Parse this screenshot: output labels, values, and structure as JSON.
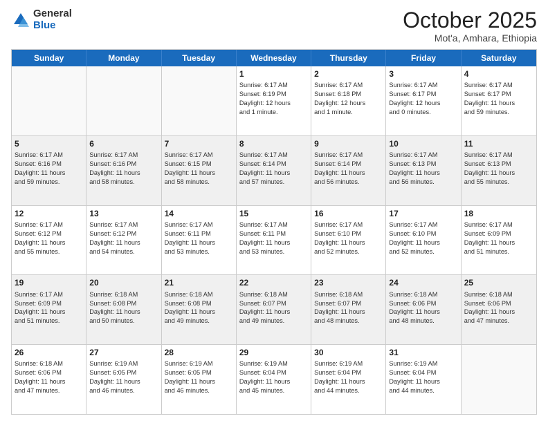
{
  "logo": {
    "general": "General",
    "blue": "Blue"
  },
  "title": "October 2025",
  "subtitle": "Mot'a, Amhara, Ethiopia",
  "days": [
    "Sunday",
    "Monday",
    "Tuesday",
    "Wednesday",
    "Thursday",
    "Friday",
    "Saturday"
  ],
  "weeks": [
    [
      {
        "day": "",
        "info": ""
      },
      {
        "day": "",
        "info": ""
      },
      {
        "day": "",
        "info": ""
      },
      {
        "day": "1",
        "info": "Sunrise: 6:17 AM\nSunset: 6:19 PM\nDaylight: 12 hours\nand 1 minute."
      },
      {
        "day": "2",
        "info": "Sunrise: 6:17 AM\nSunset: 6:18 PM\nDaylight: 12 hours\nand 1 minute."
      },
      {
        "day": "3",
        "info": "Sunrise: 6:17 AM\nSunset: 6:17 PM\nDaylight: 12 hours\nand 0 minutes."
      },
      {
        "day": "4",
        "info": "Sunrise: 6:17 AM\nSunset: 6:17 PM\nDaylight: 11 hours\nand 59 minutes."
      }
    ],
    [
      {
        "day": "5",
        "info": "Sunrise: 6:17 AM\nSunset: 6:16 PM\nDaylight: 11 hours\nand 59 minutes."
      },
      {
        "day": "6",
        "info": "Sunrise: 6:17 AM\nSunset: 6:16 PM\nDaylight: 11 hours\nand 58 minutes."
      },
      {
        "day": "7",
        "info": "Sunrise: 6:17 AM\nSunset: 6:15 PM\nDaylight: 11 hours\nand 58 minutes."
      },
      {
        "day": "8",
        "info": "Sunrise: 6:17 AM\nSunset: 6:14 PM\nDaylight: 11 hours\nand 57 minutes."
      },
      {
        "day": "9",
        "info": "Sunrise: 6:17 AM\nSunset: 6:14 PM\nDaylight: 11 hours\nand 56 minutes."
      },
      {
        "day": "10",
        "info": "Sunrise: 6:17 AM\nSunset: 6:13 PM\nDaylight: 11 hours\nand 56 minutes."
      },
      {
        "day": "11",
        "info": "Sunrise: 6:17 AM\nSunset: 6:13 PM\nDaylight: 11 hours\nand 55 minutes."
      }
    ],
    [
      {
        "day": "12",
        "info": "Sunrise: 6:17 AM\nSunset: 6:12 PM\nDaylight: 11 hours\nand 55 minutes."
      },
      {
        "day": "13",
        "info": "Sunrise: 6:17 AM\nSunset: 6:12 PM\nDaylight: 11 hours\nand 54 minutes."
      },
      {
        "day": "14",
        "info": "Sunrise: 6:17 AM\nSunset: 6:11 PM\nDaylight: 11 hours\nand 53 minutes."
      },
      {
        "day": "15",
        "info": "Sunrise: 6:17 AM\nSunset: 6:11 PM\nDaylight: 11 hours\nand 53 minutes."
      },
      {
        "day": "16",
        "info": "Sunrise: 6:17 AM\nSunset: 6:10 PM\nDaylight: 11 hours\nand 52 minutes."
      },
      {
        "day": "17",
        "info": "Sunrise: 6:17 AM\nSunset: 6:10 PM\nDaylight: 11 hours\nand 52 minutes."
      },
      {
        "day": "18",
        "info": "Sunrise: 6:17 AM\nSunset: 6:09 PM\nDaylight: 11 hours\nand 51 minutes."
      }
    ],
    [
      {
        "day": "19",
        "info": "Sunrise: 6:17 AM\nSunset: 6:09 PM\nDaylight: 11 hours\nand 51 minutes."
      },
      {
        "day": "20",
        "info": "Sunrise: 6:18 AM\nSunset: 6:08 PM\nDaylight: 11 hours\nand 50 minutes."
      },
      {
        "day": "21",
        "info": "Sunrise: 6:18 AM\nSunset: 6:08 PM\nDaylight: 11 hours\nand 49 minutes."
      },
      {
        "day": "22",
        "info": "Sunrise: 6:18 AM\nSunset: 6:07 PM\nDaylight: 11 hours\nand 49 minutes."
      },
      {
        "day": "23",
        "info": "Sunrise: 6:18 AM\nSunset: 6:07 PM\nDaylight: 11 hours\nand 48 minutes."
      },
      {
        "day": "24",
        "info": "Sunrise: 6:18 AM\nSunset: 6:06 PM\nDaylight: 11 hours\nand 48 minutes."
      },
      {
        "day": "25",
        "info": "Sunrise: 6:18 AM\nSunset: 6:06 PM\nDaylight: 11 hours\nand 47 minutes."
      }
    ],
    [
      {
        "day": "26",
        "info": "Sunrise: 6:18 AM\nSunset: 6:06 PM\nDaylight: 11 hours\nand 47 minutes."
      },
      {
        "day": "27",
        "info": "Sunrise: 6:19 AM\nSunset: 6:05 PM\nDaylight: 11 hours\nand 46 minutes."
      },
      {
        "day": "28",
        "info": "Sunrise: 6:19 AM\nSunset: 6:05 PM\nDaylight: 11 hours\nand 46 minutes."
      },
      {
        "day": "29",
        "info": "Sunrise: 6:19 AM\nSunset: 6:04 PM\nDaylight: 11 hours\nand 45 minutes."
      },
      {
        "day": "30",
        "info": "Sunrise: 6:19 AM\nSunset: 6:04 PM\nDaylight: 11 hours\nand 44 minutes."
      },
      {
        "day": "31",
        "info": "Sunrise: 6:19 AM\nSunset: 6:04 PM\nDaylight: 11 hours\nand 44 minutes."
      },
      {
        "day": "",
        "info": ""
      }
    ]
  ]
}
